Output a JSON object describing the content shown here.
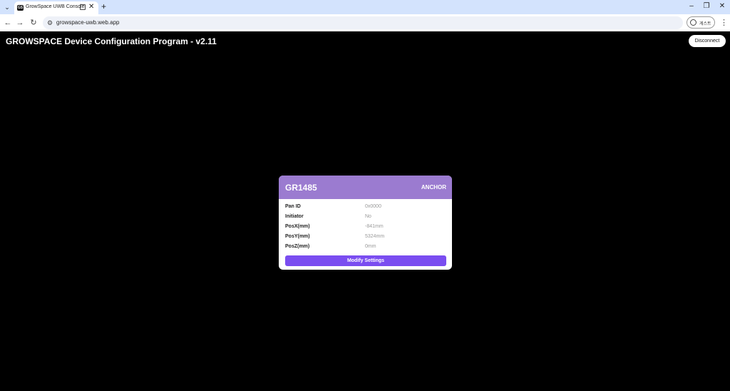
{
  "browser": {
    "tab_title": "GrowSpace UWB Console",
    "favicon_text": "GS",
    "url": "growspace-uwb.web.app",
    "profile_label": "게스트",
    "icons": {
      "tab_menu": "chevron-down-icon",
      "close": "close-icon",
      "new_tab": "plus-icon",
      "back": "arrow-left-icon",
      "forward": "arrow-right-icon",
      "reload": "reload-icon",
      "site_info": "tune-icon",
      "menu": "kebab-icon"
    }
  },
  "app": {
    "title": "GROWSPACE Device Configuration Program - v2.11",
    "disconnect_label": "Disconnect"
  },
  "device": {
    "id": "GR1485",
    "role": "ANCHOR",
    "fields": [
      {
        "label": "Pan ID",
        "value": "0x0000"
      },
      {
        "label": "Initiator",
        "value": "No"
      },
      {
        "label": "PosX(mm)",
        "value": "-841mm"
      },
      {
        "label": "PosY(mm)",
        "value": "5324mm"
      },
      {
        "label": "PosZ(mm)",
        "value": "0mm"
      }
    ],
    "modify_label": "Modify Settings",
    "header_color": "#9b7bd0",
    "button_color": "#7a4df0"
  }
}
